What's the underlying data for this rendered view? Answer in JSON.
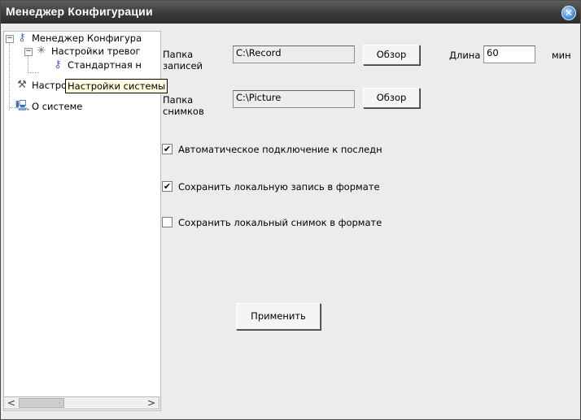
{
  "window": {
    "title": "Менеджер Конфигурации",
    "close_glyph": "✕"
  },
  "tree": {
    "root": {
      "label": "Менеджер Конфигура",
      "expander": "−",
      "icon": "key-icon"
    },
    "alarm": {
      "label": "Настройки тревог",
      "expander": "−",
      "icon": "alarm-light-icon"
    },
    "standard": {
      "label": "Стандартная н",
      "icon": "key-icon"
    },
    "system": {
      "label": "Настройки системы",
      "icon": "tools-icon"
    },
    "about": {
      "label": "О системе",
      "icon": "computer-icon"
    },
    "tooltip": "Настройки системы",
    "scroll_left": "<",
    "scroll_right": ">"
  },
  "form": {
    "record_folder_label": "Папка записей",
    "record_folder_value": "C:\\Record",
    "browse1_label": "Обзор",
    "length_label": "Длина",
    "length_value": "60",
    "length_unit": "мин",
    "snapshot_folder_label": "Папка снимков",
    "snapshot_folder_value": "C:\\Picture",
    "browse2_label": "Обзор",
    "auto_connect": {
      "label": "Автоматическое подключение к последн",
      "checked": true
    },
    "save_record_format": {
      "label": "Сохранить локальную запись в формате",
      "checked": true
    },
    "save_snapshot_format": {
      "label": "Сохранить локальный снимок в формате",
      "checked": false
    },
    "apply_label": "Применить",
    "check_glyph": "✔"
  }
}
